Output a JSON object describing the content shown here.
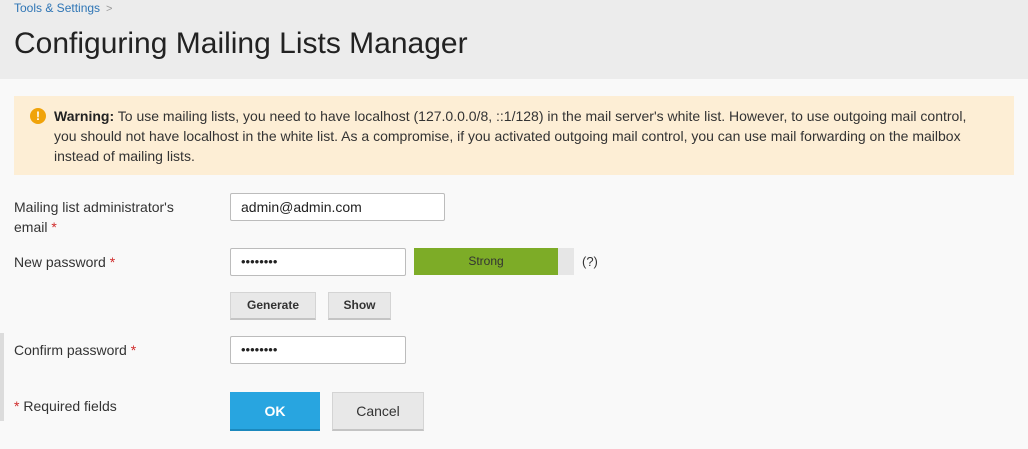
{
  "breadcrumb": {
    "items": [
      "Tools & Settings"
    ],
    "separator": ">"
  },
  "page": {
    "title": "Configuring Mailing Lists Manager"
  },
  "warning": {
    "icon": "warning-icon",
    "icon_glyph": "!",
    "bold_label": "Warning:",
    "text": " To use mailing lists, you need to have localhost (127.0.0.0/8, ::1/128) in the mail server's white list. However, to use outgoing mail control, you should not have localhost in the white list. As a compromise, if you activated outgoing mail control, you can use mail forwarding on the mailbox instead of mailing lists."
  },
  "form": {
    "admin_email": {
      "label_line1": "Mailing list administrator's",
      "label_line2": "email",
      "required_mark": "*",
      "value": "admin@admin.com"
    },
    "new_password": {
      "label": "New password",
      "required_mark": "*",
      "value_masked": "••••••••",
      "strength_label": "Strong",
      "strength_fraction": 0.9,
      "help": "(?)"
    },
    "generate_label": "Generate",
    "show_label": "Show",
    "confirm_password": {
      "label": "Confirm password",
      "required_mark": "*",
      "value_masked": "••••••••"
    },
    "required_note_mark": "*",
    "required_note": "Required fields",
    "ok_label": "OK",
    "cancel_label": "Cancel"
  },
  "colors": {
    "header_bg": "#ececec",
    "link": "#2e75b5",
    "warning_bg": "#fdeed5",
    "warning_icon": "#f0a30a",
    "strength_strong": "#7dac27",
    "primary_button": "#28a5e0",
    "required": "#d02b2b"
  }
}
